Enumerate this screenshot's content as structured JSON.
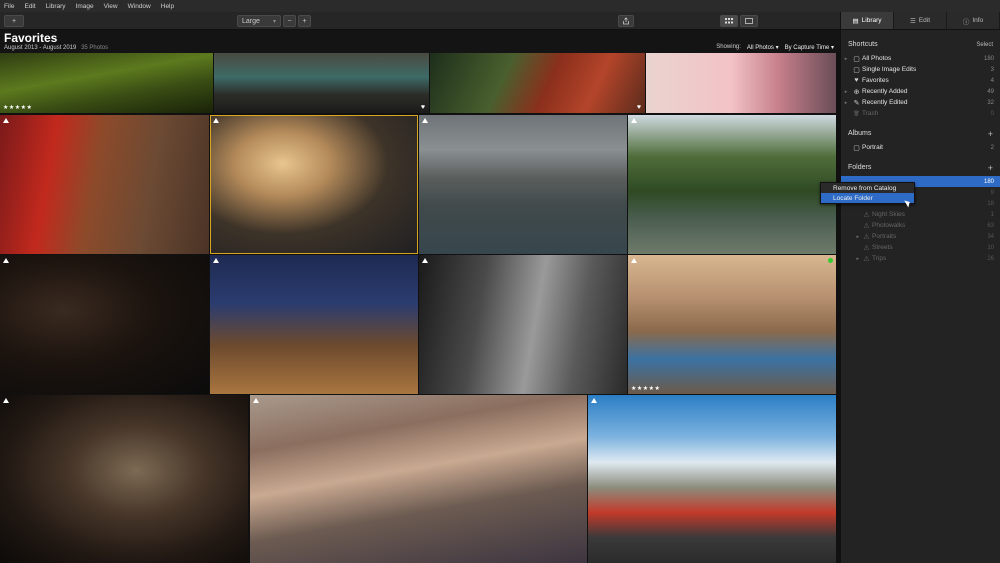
{
  "menu": [
    "File",
    "Edit",
    "Library",
    "Image",
    "View",
    "Window",
    "Help"
  ],
  "toolbar": {
    "add": "+",
    "size": "Large",
    "size_chevron": "▾",
    "zoom_out": "−",
    "zoom_in": "+",
    "share_icon": "share-icon",
    "grid_icon": "grid-view-icon",
    "single_icon": "single-view-icon"
  },
  "header": {
    "title": "Favorites",
    "date_range": "August 2013 - August 2019",
    "photo_count": "35 Photos",
    "showing_label": "Showing:",
    "showing_value": "All Photos ▾",
    "sort_value": "By Capture Time ▾"
  },
  "sidebar": {
    "tabs": [
      {
        "label": "Library",
        "icon": "library-icon",
        "glyph": "▤"
      },
      {
        "label": "Edit",
        "icon": "sliders-icon",
        "glyph": "☰"
      },
      {
        "label": "Info",
        "icon": "info-icon",
        "glyph": "ⓘ"
      }
    ],
    "shortcuts": {
      "title": "Shortcuts",
      "action": "Select",
      "items": [
        {
          "label": "All Photos",
          "count": "180",
          "icon": "▢",
          "arrow": "▸"
        },
        {
          "label": "Single Image Edits",
          "count": "3",
          "icon": "▢",
          "arrow": ""
        },
        {
          "label": "Favorites",
          "count": "4",
          "icon": "♥",
          "arrow": ""
        },
        {
          "label": "Recently Added",
          "count": "49",
          "icon": "⊕",
          "arrow": "▸"
        },
        {
          "label": "Recently Edited",
          "count": "32",
          "icon": "✎",
          "arrow": "▸"
        },
        {
          "label": "Trash",
          "count": "0",
          "icon": "🗑",
          "arrow": ""
        }
      ]
    },
    "albums": {
      "title": "Albums",
      "add": "+",
      "items": [
        {
          "label": "Portrait",
          "count": "2",
          "icon": "▢"
        }
      ]
    },
    "folders": {
      "title": "Folders",
      "add": "+",
      "counts_top": [
        "180",
        "9"
      ],
      "items": [
        {
          "label": "",
          "count": "18",
          "arrow": ""
        },
        {
          "label": "Night Skies",
          "count": "1",
          "arrow": ""
        },
        {
          "label": "Photowalks",
          "count": "63",
          "arrow": ""
        },
        {
          "label": "Portraits",
          "count": "34",
          "arrow": "▸"
        },
        {
          "label": "Streets",
          "count": "10",
          "arrow": ""
        },
        {
          "label": "Trips",
          "count": "26",
          "arrow": "▸"
        }
      ]
    }
  },
  "context_menu": {
    "items": [
      "Remove from Catalog",
      "Locate Folder"
    ]
  },
  "photos": {
    "stars": "★★★★★",
    "heart": "♥",
    "warning": "⚠"
  }
}
